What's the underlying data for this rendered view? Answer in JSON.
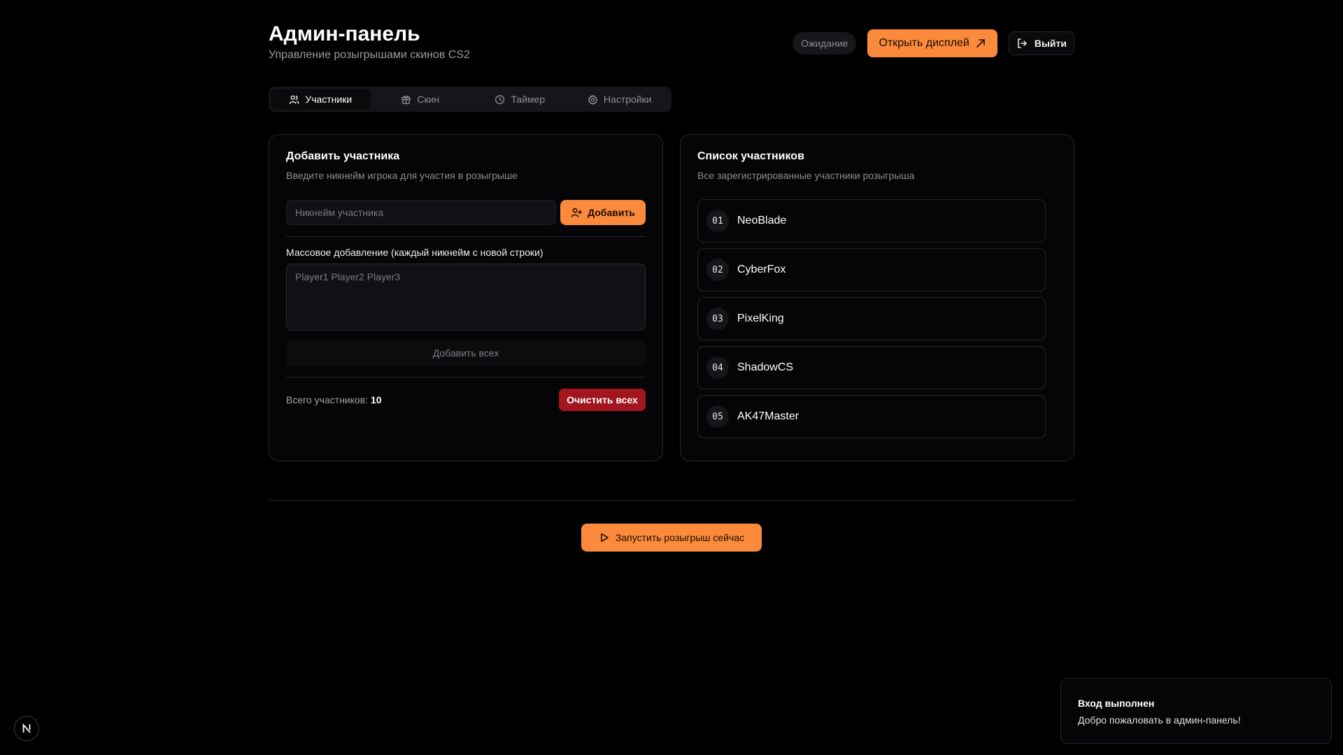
{
  "header": {
    "title": "Админ-панель",
    "subtitle": "Управление розыгрышами скинов CS2",
    "status": "Ожидание",
    "open_display_label": "Открыть дисплей",
    "logout_label": "Выйти"
  },
  "tabs": [
    {
      "label": "Участники",
      "icon": "users-icon",
      "active": true
    },
    {
      "label": "Скин",
      "icon": "gift-icon",
      "active": false
    },
    {
      "label": "Таймер",
      "icon": "clock-icon",
      "active": false
    },
    {
      "label": "Настройки",
      "icon": "gear-icon",
      "active": false
    }
  ],
  "add_card": {
    "title": "Добавить участника",
    "description": "Введите никнейм игрока для участия в розыгрыше",
    "input_placeholder": "Никнейм участника",
    "add_label": "Добавить",
    "bulk_label": "Массовое добавление (каждый никнейм с новой строки)",
    "bulk_placeholder": "Player1 Player2 Player3",
    "add_all_label": "Добавить всех",
    "total_label": "Всего участников:",
    "total_count": "10",
    "clear_label": "Очистить всех"
  },
  "list_card": {
    "title": "Список участников",
    "description": "Все зарегистрированные участники розыгрыша",
    "participants": [
      {
        "num": "01",
        "name": "NeoBlade"
      },
      {
        "num": "02",
        "name": "CyberFox"
      },
      {
        "num": "03",
        "name": "PixelKing"
      },
      {
        "num": "04",
        "name": "ShadowCS"
      },
      {
        "num": "05",
        "name": "AK47Master"
      }
    ]
  },
  "start_label": "Запустить розыгрыш сейчас",
  "toast": {
    "title": "Вход выполнен",
    "message": "Добро пожаловать в админ-панель!"
  },
  "colors": {
    "accent": "#fb8a3c",
    "danger": "#a3151f",
    "background": "#000000"
  }
}
